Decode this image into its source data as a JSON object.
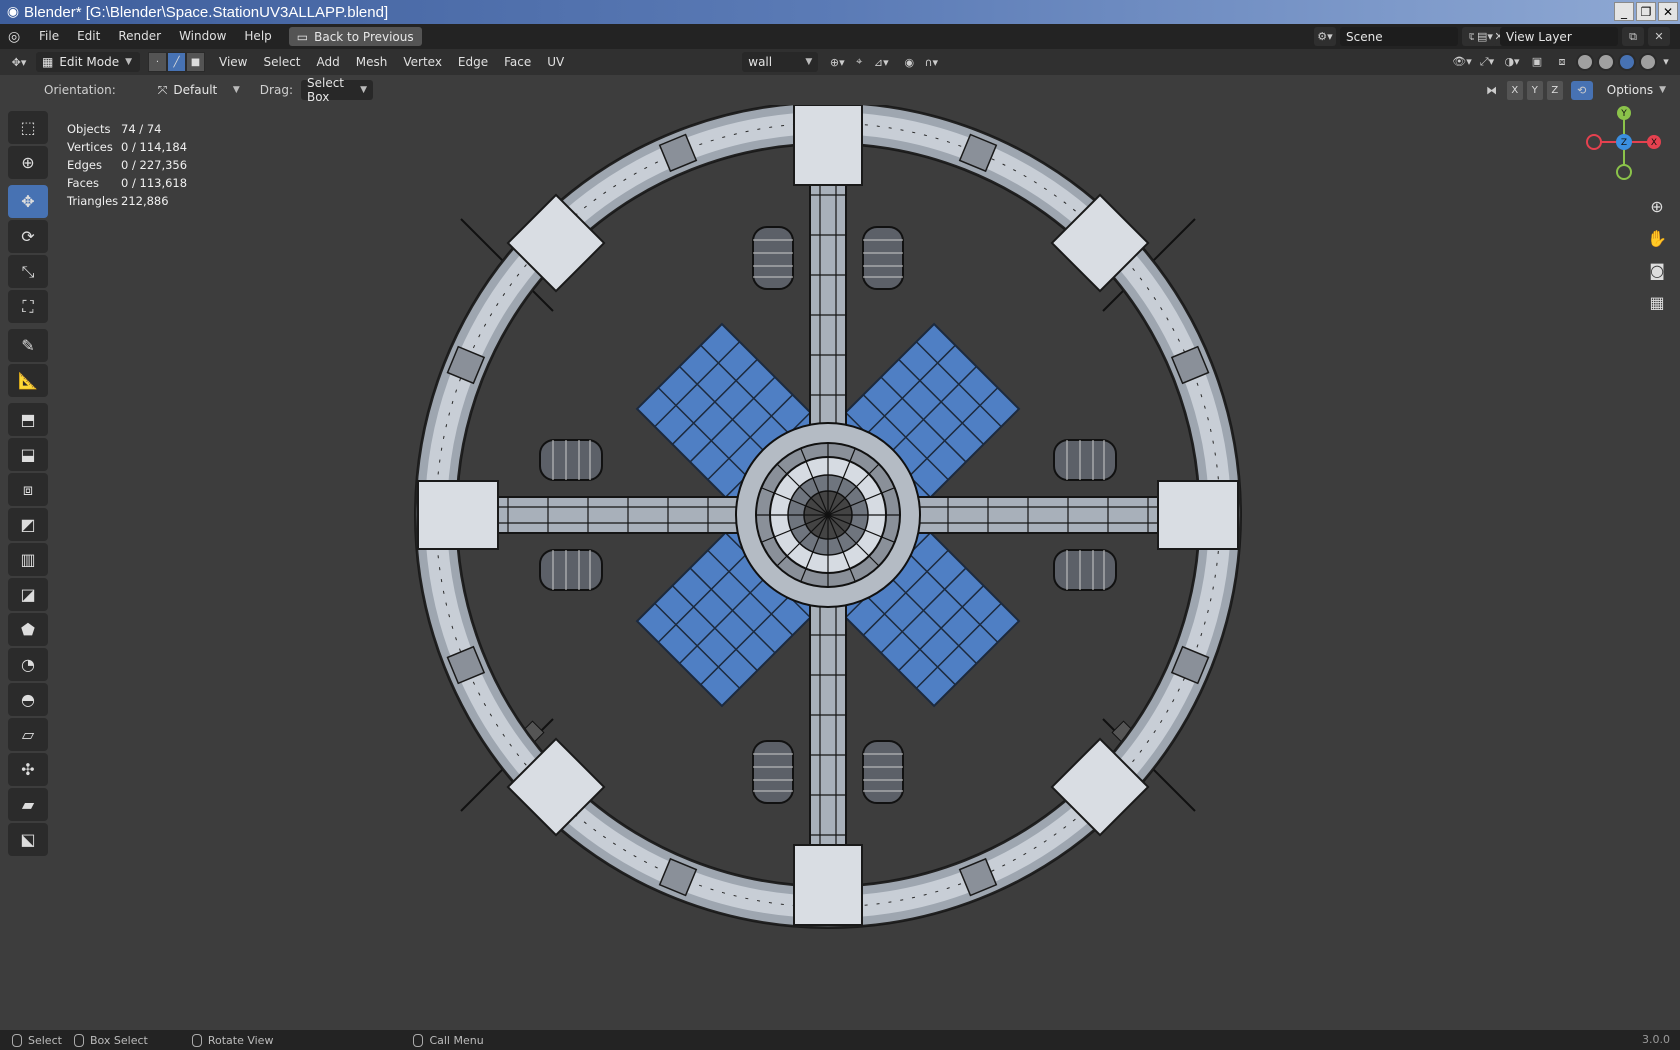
{
  "window": {
    "title": "Blender* [G:\\Blender\\Space.StationUV3ALLAPP.blend]",
    "minimize": "_",
    "restore": "❐",
    "close": "✕"
  },
  "menubar": {
    "items": [
      "File",
      "Edit",
      "Render",
      "Window",
      "Help"
    ],
    "back_button": "Back to Previous",
    "scene": "Scene",
    "view_layer": "View Layer"
  },
  "header": {
    "mode": "Edit Mode",
    "menus": [
      "View",
      "Select",
      "Add",
      "Mesh",
      "Vertex",
      "Edge",
      "Face",
      "UV"
    ],
    "uv_map": "wall"
  },
  "toolheader": {
    "orientation_label": "Orientation:",
    "orientation_value": "Default",
    "drag_label": "Drag:",
    "drag_value": "Select Box",
    "axes": [
      "X",
      "Y",
      "Z"
    ],
    "options": "Options"
  },
  "stats": [
    {
      "label": "Objects",
      "value": "74 / 74"
    },
    {
      "label": "Vertices",
      "value": "0 / 114,184"
    },
    {
      "label": "Edges",
      "value": "0 / 227,356"
    },
    {
      "label": "Faces",
      "value": "0 / 113,618"
    },
    {
      "label": "Triangles",
      "value": "212,886"
    }
  ],
  "gizmo": {
    "x": "X",
    "y": "Y",
    "z": "Z",
    "colors": {
      "x": "#e5414f",
      "y": "#8bc34a",
      "z": "#3b8fe0"
    }
  },
  "statusbar": {
    "select": "Select",
    "box_select": "Box Select",
    "rotate_view": "Rotate View",
    "call_menu": "Call Menu",
    "version": "3.0.0"
  },
  "colors": {
    "accent": "#4772b3",
    "solar_panel": "#4f7fc4",
    "viewport_bg": "#3d3d3d"
  }
}
